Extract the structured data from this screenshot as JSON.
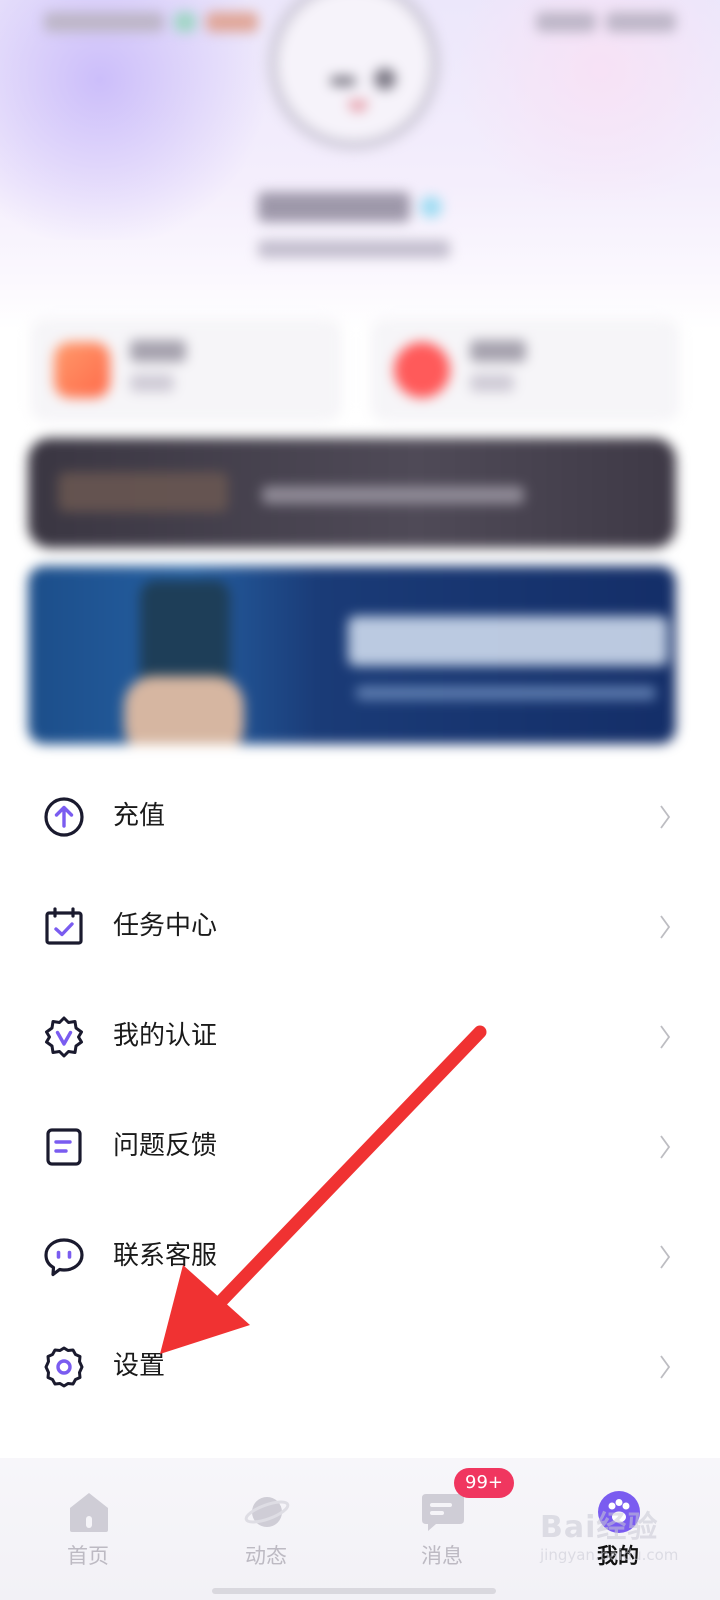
{
  "colors": {
    "accent": "#7a5cf0",
    "icon_stroke": "#1a1a2e",
    "arrow": "#f03232",
    "badge": "#f0365f"
  },
  "menu": {
    "items": [
      {
        "label": "充值",
        "icon": "upload-circle-icon"
      },
      {
        "label": "任务中心",
        "icon": "calendar-check-icon"
      },
      {
        "label": "我的认证",
        "icon": "verified-badge-icon"
      },
      {
        "label": "问题反馈",
        "icon": "feedback-doc-icon"
      },
      {
        "label": "联系客服",
        "icon": "chat-bubble-icon"
      },
      {
        "label": "设置",
        "icon": "gear-icon"
      }
    ]
  },
  "bottom_nav": {
    "items": [
      {
        "label": "首页",
        "icon": "home-icon"
      },
      {
        "label": "动态",
        "icon": "planet-icon"
      },
      {
        "label": "消息",
        "icon": "message-icon"
      },
      {
        "label": "我的",
        "icon": "profile-paw-icon",
        "active": true
      }
    ],
    "message_badge": "99+"
  },
  "watermark": {
    "text": "Bai经验",
    "sub": "jingyan.baidu.com"
  }
}
